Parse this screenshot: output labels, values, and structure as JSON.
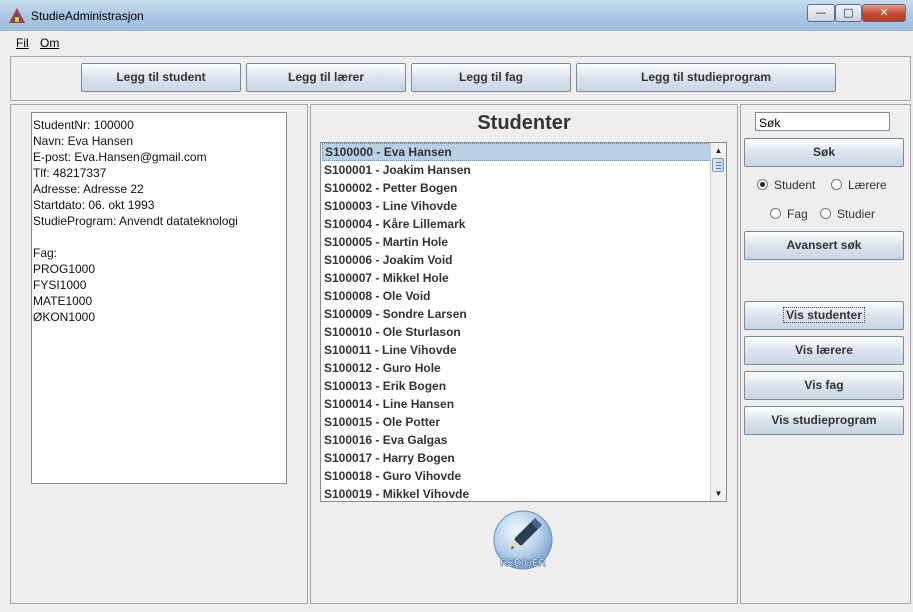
{
  "window": {
    "title": "StudieAdministrasjon",
    "controls": {
      "minimize": "—",
      "maximize": "□",
      "close": "✕"
    }
  },
  "menu": [
    {
      "label": "Fil"
    },
    {
      "label": "Om"
    }
  ],
  "toolbar": {
    "add_student": "Legg til student",
    "add_teacher": "Legg til lærer",
    "add_subject": "Legg til fag",
    "add_program": "Legg til studieprogram"
  },
  "details": {
    "lines": [
      "StudentNr: 100000",
      "Navn: Eva Hansen",
      "E-post: Eva.Hansen@gmail.com",
      "Tlf: 48217337",
      "Adresse: Adresse 22",
      "Startdato: 06. okt 1993",
      "StudieProgram: Anvendt datateknologi",
      "",
      "Fag:",
      "PROG1000",
      "FYSI1000",
      "MATE1000",
      "ØKON1000"
    ]
  },
  "list": {
    "title": "Studenter",
    "selected_index": 0,
    "items": [
      "S100000 - Eva Hansen",
      "S100001 - Joakim Hansen",
      "S100002 - Petter Bogen",
      "S100003 - Line Vihovde",
      "S100004 - Kåre Lillemark",
      "S100005 - Martin Hole",
      "S100006 - Joakim Void",
      "S100007 - Mikkel Hole",
      "S100008 - Ole Void",
      "S100009 - Sondre Larsen",
      "S100010 - Ole Sturlason",
      "S100011 - Line Vihovde",
      "S100012 - Guro Hole",
      "S100013 - Erik Bogen",
      "S100014 - Line Hansen",
      "S100015 - Ole Potter",
      "S100016 - Eva Galgas",
      "S100017 - Harry Bogen",
      "S100018 - Guro Vihovde",
      "S100019 - Mikkel Vihovde"
    ]
  },
  "edit": {
    "label": "REDIGER",
    "icon": "pencil-icon"
  },
  "search": {
    "value": "Søk",
    "button": "Søk",
    "radios": {
      "student": "Student",
      "teachers": "Lærere",
      "subject": "Fag",
      "programs": "Studier"
    },
    "selected": "Student",
    "advanced": "Avansert søk"
  },
  "show": {
    "students": "Vis studenter",
    "teachers": "Vis lærere",
    "subjects": "Vis fag",
    "programs": "Vis studieprogram"
  },
  "colors": {
    "selection": "#b8cfe5",
    "titlebar": "#a9c5e2",
    "close": "#c54a2e"
  }
}
